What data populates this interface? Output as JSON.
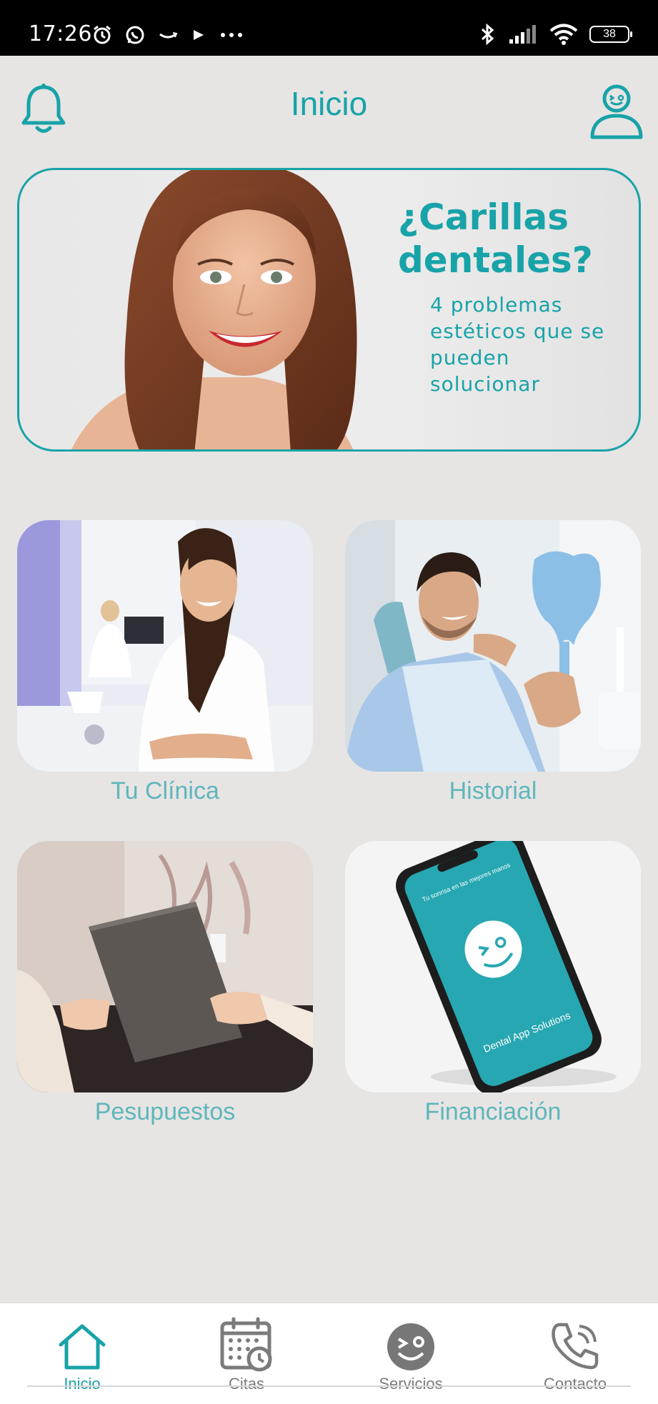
{
  "status_bar": {
    "time": "17:26",
    "battery": "38"
  },
  "header": {
    "title": "Inicio"
  },
  "banner": {
    "title": "¿Carillas dentales?",
    "subtitle": "4 problemas estéticos que se pueden solucionar"
  },
  "tiles": [
    {
      "label": "Tu Clínica"
    },
    {
      "label": "Historial"
    },
    {
      "label": "Pesupuestos"
    },
    {
      "label": "Financiación"
    }
  ],
  "phone_mock": {
    "tagline": "Tu sonrisa en las mejores manos",
    "brand": "Dental App Solutions"
  },
  "bottom_nav": {
    "items": [
      {
        "label": "Inicio",
        "icon": "home-icon",
        "active": true
      },
      {
        "label": "Citas",
        "icon": "calendar-icon",
        "active": false
      },
      {
        "label": "Servicios",
        "icon": "wink-face-icon",
        "active": false
      },
      {
        "label": "Contacto",
        "icon": "phone-icon",
        "active": false
      }
    ]
  },
  "colors": {
    "accent": "#18a3a8",
    "label": "#5fb6ba",
    "background": "#e6e5e4",
    "nav_inactive": "#7b7b7b"
  }
}
